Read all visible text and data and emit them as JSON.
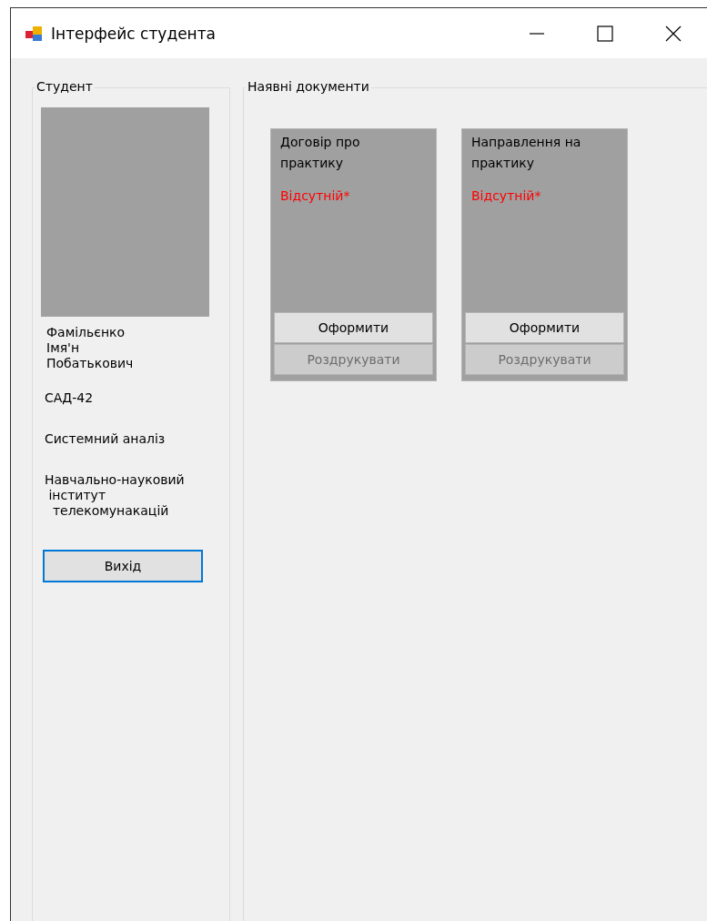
{
  "window": {
    "title": "Інтерфейс студента"
  },
  "student": {
    "title": "Студент",
    "name_lines": [
      "Фамільєнко",
      "Імя'н",
      "Побатькович"
    ],
    "group": "САД-42",
    "specialty": "Системний аналіз",
    "institute_lines": [
      "Навчально-науковий",
      " інститут",
      "  телекомунакацій"
    ],
    "exit_button": "Вихід"
  },
  "documents": {
    "title": "Наявні документи",
    "items": [
      {
        "name": "Договір про практику",
        "status": "Відсутній*",
        "create_button": {
          "label": "Оформити",
          "disabled": false
        },
        "print_button": {
          "label": "Роздрукувати",
          "disabled": true
        }
      },
      {
        "name": "Направлення на практику",
        "status": "Відсутній*",
        "create_button": {
          "label": "Оформити",
          "disabled": false
        },
        "print_button": {
          "label": "Роздрукувати",
          "disabled": true
        }
      }
    ]
  }
}
